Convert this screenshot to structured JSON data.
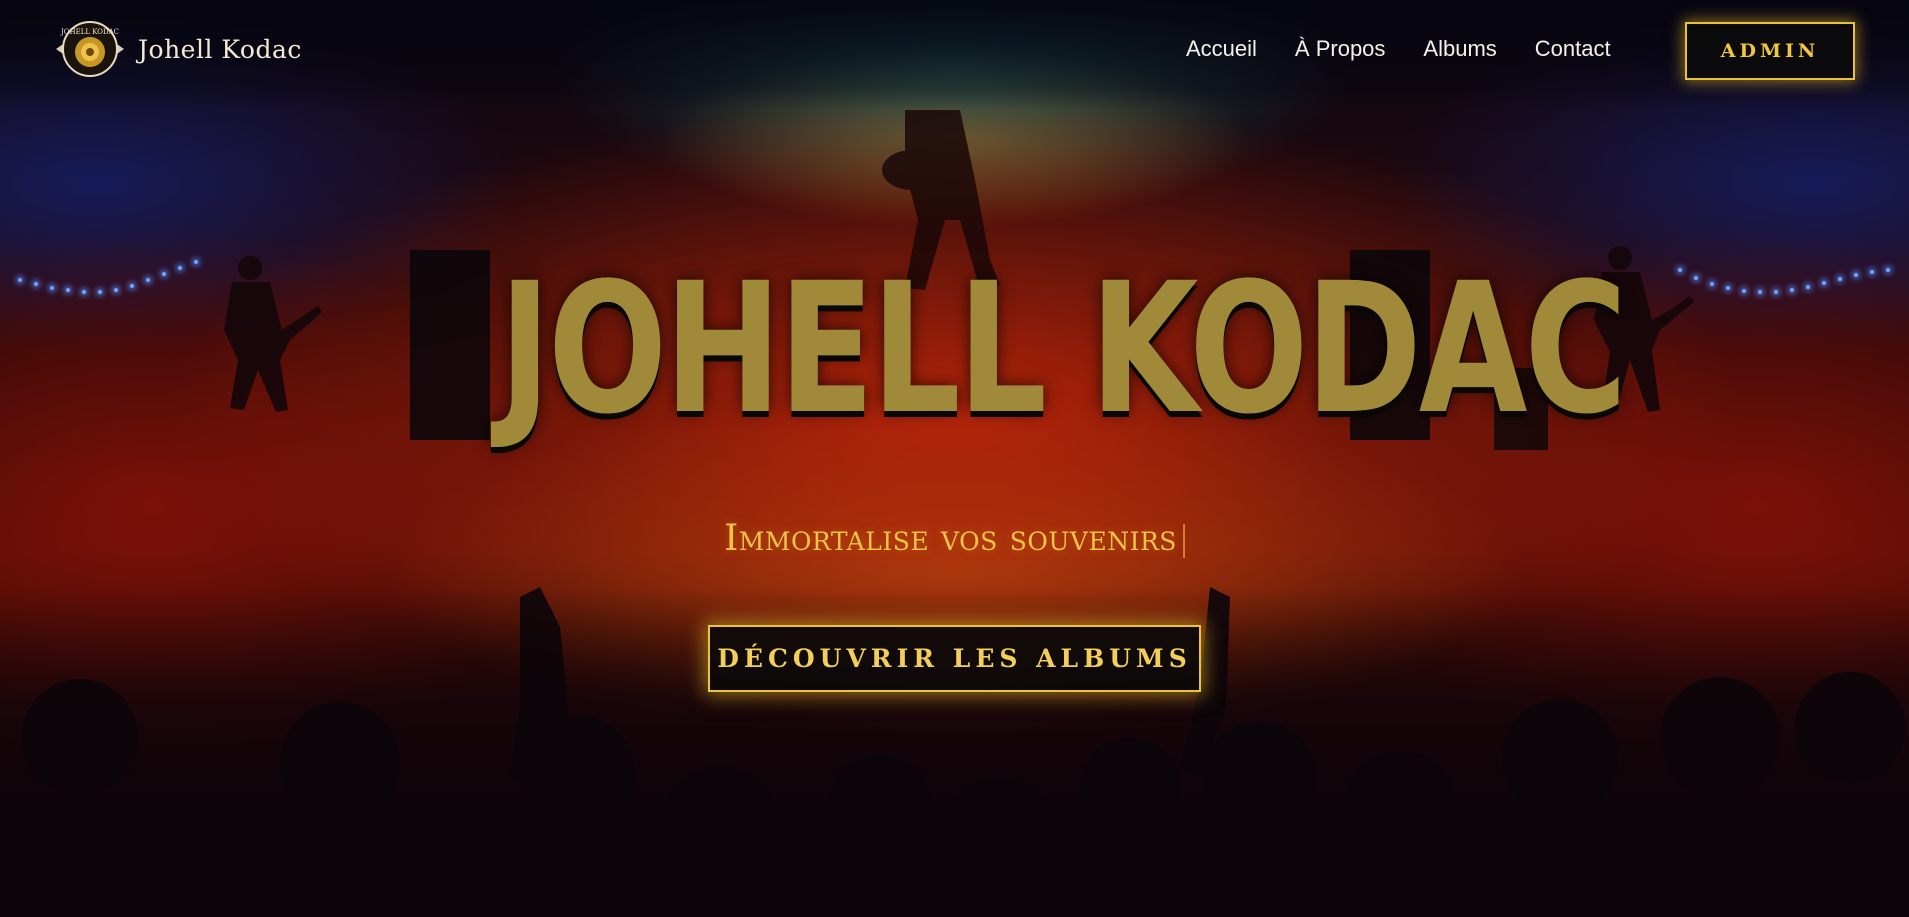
{
  "brand": {
    "name": "Johell Kodac",
    "logo_icon": "camera-badge-logo",
    "logo_text": "JOHELL KODAC"
  },
  "nav": {
    "links": [
      {
        "label": "Accueil"
      },
      {
        "label": "À Propos"
      },
      {
        "label": "Albums"
      },
      {
        "label": "Contact"
      }
    ],
    "admin_label": "ADMIN"
  },
  "hero": {
    "title": "JOHELL KODAC",
    "tagline": "Immortalise vos souvenirs",
    "cta_label": "DÉCOUVRIR LES ALBUMS",
    "background": "concert-stage-crowd-image"
  },
  "colors": {
    "accent_gold": "#e8c23a",
    "title_gold": "#a08a3a",
    "nav_text": "#f5f2ec",
    "stage_red": "#c8280a"
  }
}
